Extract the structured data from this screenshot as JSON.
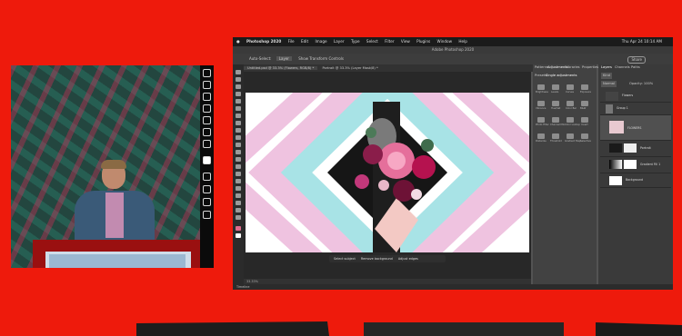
{
  "colors": {
    "stage": "#ee1a0c",
    "accent": "#2680eb"
  },
  "menubar": {
    "apple": "",
    "items": [
      "Photoshop 2020",
      "File",
      "Edit",
      "Image",
      "Layer",
      "Type",
      "Select",
      "Filter",
      "View",
      "Plugins",
      "Window",
      "Help"
    ],
    "status": "Thu Apr 24 10:14 AM"
  },
  "titlebar": {
    "title": "Adobe Photoshop 2020"
  },
  "optionsbar": {
    "auto_select": "Auto-Select:",
    "layer": "Layer",
    "transform": "Show Transform Controls",
    "share": "Share"
  },
  "tabs": [
    {
      "label": "Untitled.psd @ 33.3% (Flowers, RGB/8) *"
    },
    {
      "label": "Portrait @ 33.3% (Layer Mask/8) *"
    }
  ],
  "taskbar": {
    "items": [
      "Select subject",
      "Remove background",
      "Adjust edges"
    ]
  },
  "statusbar": {
    "zoom": "33.33%"
  },
  "timeline": {
    "label": "Timeline"
  },
  "right_panel": {
    "tabs": [
      "Patterns",
      "Adjustments",
      "Libraries",
      "Properties"
    ],
    "subtabs": [
      "Presets",
      "Single adjustments"
    ],
    "adjustments": [
      "Brightness",
      "Levels",
      "Curves",
      "Exposure",
      "Vibrance",
      "Hue/Sat",
      "Color Bal",
      "B&W",
      "Photo Filter",
      "Channel Mix",
      "Color Lookup",
      "Invert",
      "Posterize",
      "Threshold",
      "Gradient Map",
      "Selective"
    ]
  },
  "layers_panel": {
    "tabs": [
      "Layers",
      "Channels",
      "Paths"
    ],
    "filter": "Kind",
    "blend": "Normal",
    "opacity": "Opacity: 100%",
    "layers": [
      {
        "name": "Flowers"
      },
      {
        "name": "Group 1"
      },
      {
        "name": "FLOWERS"
      },
      {
        "name": "Portrait"
      },
      {
        "name": "Gradient Fill 1"
      },
      {
        "name": "Background"
      }
    ]
  }
}
